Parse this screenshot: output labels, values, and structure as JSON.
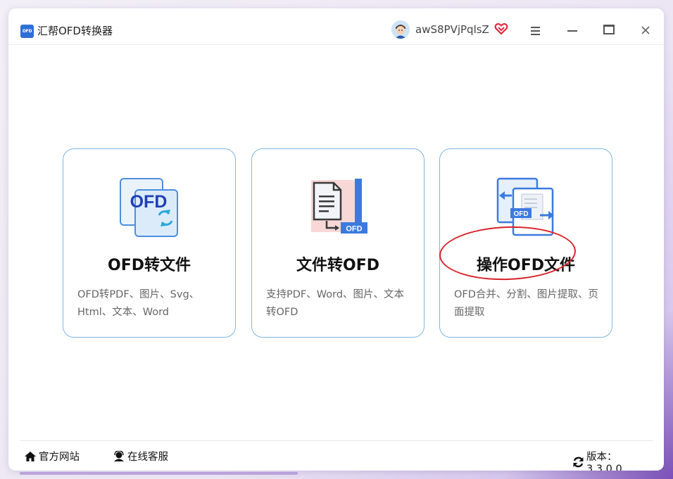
{
  "app": {
    "logo_text": "OFD",
    "title": "汇帮OFD转换器"
  },
  "user": {
    "name": "awS8PVjPqlsZ"
  },
  "cards": [
    {
      "icon": "ofd-convert-icon",
      "title": "OFD转文件",
      "desc": "OFD转PDF、图片、Svg、Html、文本、Word"
    },
    {
      "icon": "file-to-ofd-icon",
      "title": "文件转OFD",
      "desc": "支持PDF、Word、图片、文本转OFD",
      "icon_label": "OFD"
    },
    {
      "icon": "ofd-operate-icon",
      "title": "操作OFD文件",
      "desc": "OFD合并、分割、图片提取、页面提取",
      "icon_label": "OFD",
      "highlighted": true
    }
  ],
  "footer": {
    "website_label": "官方网站",
    "support_label": "在线客服",
    "version_label": "版本：3.3.0.0"
  },
  "colors": {
    "accent": "#2f6fd8",
    "card_border": "#7fb6e3",
    "highlight": "#d8232a"
  }
}
